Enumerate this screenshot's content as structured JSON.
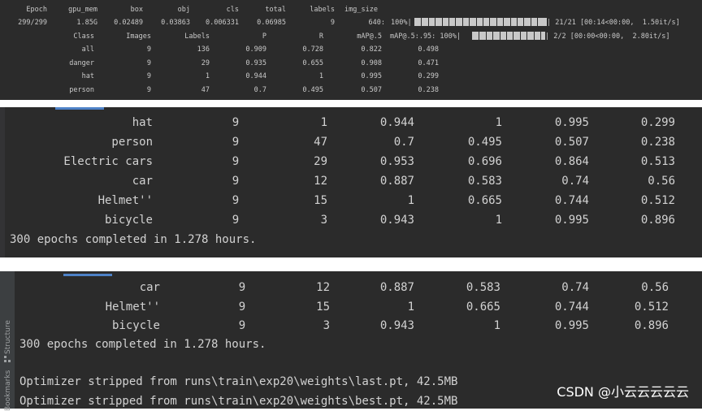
{
  "training_log": {
    "header": [
      "Epoch",
      "gpu_mem",
      "box",
      "obj",
      "cls",
      "total",
      "labels",
      "img_size"
    ],
    "epoch_row": {
      "epoch": "299/299",
      "gpu_mem": "1.85G",
      "box": "0.02489",
      "obj": "0.03863",
      "cls": "0.006331",
      "total": "0.06985",
      "labels": "9",
      "img_size": "640:",
      "pct": "100%|",
      "progress": 1.0,
      "tail": "| 21/21 [00:14<00:00,  1.50it/s]"
    },
    "val_header": [
      "Class",
      "Images",
      "Labels",
      "P",
      "R",
      "mAP@.5",
      "mAP@.5:.95: 100%|"
    ],
    "val_tail": "| 2/2 [00:00<00:00,  2.80it/s]",
    "val_progress": 1.0,
    "val_rows": [
      [
        "all",
        "9",
        "136",
        "0.909",
        "0.728",
        "0.822",
        "0.498"
      ],
      [
        "danger",
        "9",
        "29",
        "0.935",
        "0.655",
        "0.908",
        "0.471"
      ],
      [
        "hat",
        "9",
        "1",
        "0.944",
        "1",
        "0.995",
        "0.299"
      ],
      [
        "person",
        "9",
        "47",
        "0.7",
        "0.495",
        "0.507",
        "0.238"
      ]
    ]
  },
  "results_panel": {
    "rows": [
      [
        "hat",
        "9",
        "1",
        "0.944",
        "1",
        "0.995",
        "0.299"
      ],
      [
        "person",
        "9",
        "47",
        "0.7",
        "0.495",
        "0.507",
        "0.238"
      ],
      [
        "Electric cars",
        "9",
        "29",
        "0.953",
        "0.696",
        "0.864",
        "0.513"
      ],
      [
        "car",
        "9",
        "12",
        "0.887",
        "0.583",
        "0.74",
        "0.56"
      ],
      [
        "Helmet''",
        "9",
        "15",
        "1",
        "0.665",
        "0.744",
        "0.512"
      ],
      [
        "bicycle",
        "9",
        "3",
        "0.943",
        "1",
        "0.995",
        "0.896"
      ]
    ],
    "completed": "300 epochs completed in 1.278 hours."
  },
  "console_panel": {
    "side_labels": [
      "Structure",
      "Bookmarks"
    ],
    "rows": [
      [
        "car",
        "9",
        "12",
        "0.887",
        "0.583",
        "0.74",
        "0.56"
      ],
      [
        "Helmet''",
        "9",
        "15",
        "1",
        "0.665",
        "0.744",
        "0.512"
      ],
      [
        "bicycle",
        "9",
        "3",
        "0.943",
        "1",
        "0.995",
        "0.896"
      ]
    ],
    "completed": "300 epochs completed in 1.278 hours.",
    "optimizer_lines": [
      "Optimizer stripped from runs\\train\\exp20\\weights\\last.pt, 42.5MB",
      "Optimizer stripped from runs\\train\\exp20\\weights\\best.pt, 42.5MB"
    ]
  },
  "watermark": "CSDN @小云云云云云"
}
